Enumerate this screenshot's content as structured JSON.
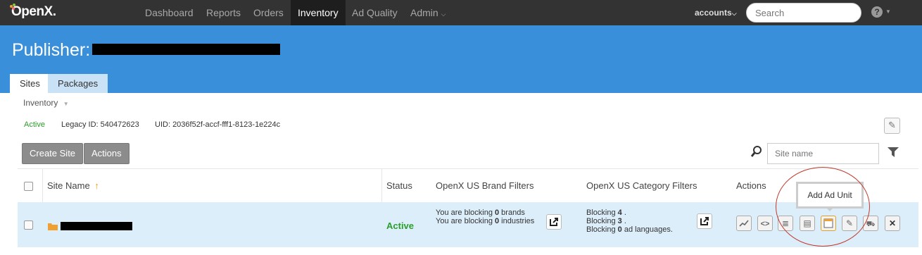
{
  "app": {
    "logo_text": "OpenX.",
    "nav": [
      "Dashboard",
      "Reports",
      "Orders",
      "Inventory",
      "Ad Quality",
      "Admin"
    ],
    "accounts_label": "accounts",
    "search_placeholder": "Search",
    "help_label": "?"
  },
  "header": {
    "title_prefix": "Publisher:",
    "tabs": [
      "Sites",
      "Packages"
    ]
  },
  "breadcrumb": {
    "label": "Inventory"
  },
  "meta": {
    "status": "Active",
    "legacy_id_label": "Legacy ID:",
    "legacy_id_value": "540472623",
    "uid_label": "UID:",
    "uid_value": "2036f52f-accf-fff1-8123-1e224c"
  },
  "toolbar": {
    "create_site": "Create Site",
    "actions": "Actions",
    "site_name_placeholder": "Site name"
  },
  "table": {
    "headers": {
      "site_name": "Site Name",
      "sort_arrow": "↑",
      "status": "Status",
      "brand_filters": "OpenX US Brand Filters",
      "category_filters": "OpenX US Category Filters",
      "actions": "Actions"
    },
    "row": {
      "status": "Active",
      "brand_line1_prefix": "You are blocking ",
      "brand_line1_count": "0",
      "brand_line1_suffix": " brands",
      "brand_line2_prefix": "You are blocking ",
      "brand_line2_count": "0",
      "brand_line2_suffix": " industries",
      "cat_line1_prefix": "Blocking ",
      "cat_line1_count": "4",
      "cat_line1_suffix": " .",
      "cat_line2_prefix": "Blocking ",
      "cat_line2_count": "3",
      "cat_line2_suffix": " .",
      "cat_line3_prefix": "Blocking ",
      "cat_line3_count": "0",
      "cat_line3_suffix": " ad languages."
    }
  },
  "tooltip": {
    "text": "Add Ad Unit"
  },
  "colors": {
    "nav_bg": "#333333",
    "banner_bg": "#3a8fda",
    "active_green": "#2a9d2a",
    "row_highlight": "#dceefa",
    "annotation_red": "#c0392b"
  }
}
